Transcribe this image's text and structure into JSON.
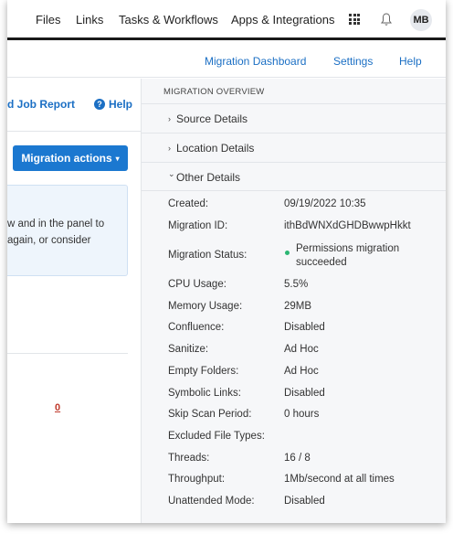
{
  "topnav": {
    "files": "Files",
    "links": "Links",
    "tasks": "Tasks & Workflows",
    "apps": "Apps & Integrations",
    "avatar_initials": "MB",
    "apps_grid_icon": "grid-icon",
    "notifications_icon": "bell-icon"
  },
  "subnav": {
    "dashboard": "Migration Dashboard",
    "settings": "Settings",
    "help": "Help"
  },
  "left": {
    "job_report": "d Job Report",
    "help": "Help",
    "actions_button": "Migration actions",
    "actions_caret": "▾",
    "info_line1": "w and in the panel to",
    "info_line2": "again, or consider",
    "count_link": "0"
  },
  "overview": {
    "title": "MIGRATION OVERVIEW",
    "sections": [
      {
        "label": "Source Details",
        "chevron": "›"
      },
      {
        "label": "Location Details",
        "chevron": "›"
      },
      {
        "label": "Other Details",
        "chevron": "⌄"
      }
    ],
    "details": [
      {
        "key": "Created:",
        "value": "09/19/2022 10:35"
      },
      {
        "key": "Migration ID:",
        "value": "ithBdWNXdGHDBwwpHkkt"
      },
      {
        "key": "Migration Status:",
        "value": "Permissions migration succeeded"
      },
      {
        "key": "CPU Usage:",
        "value": "5.5%"
      },
      {
        "key": "Memory Usage:",
        "value": "29MB"
      },
      {
        "key": "Confluence:",
        "value": "Disabled"
      },
      {
        "key": "Sanitize:",
        "value": "Ad Hoc"
      },
      {
        "key": "Empty Folders:",
        "value": "Ad Hoc"
      },
      {
        "key": "Symbolic Links:",
        "value": "Disabled"
      },
      {
        "key": "Skip Scan Period:",
        "value": "0 hours"
      },
      {
        "key": "Excluded File Types:",
        "value": ""
      },
      {
        "key": "Threads:",
        "value": "16 / 8"
      },
      {
        "key": "Throughput:",
        "value": "1Mb/second at all times"
      },
      {
        "key": "Unattended Mode:",
        "value": "Disabled"
      }
    ],
    "status_color": "#2bb673"
  },
  "colors": {
    "accent": "#1b78d0",
    "link": "#1b6fc4"
  }
}
